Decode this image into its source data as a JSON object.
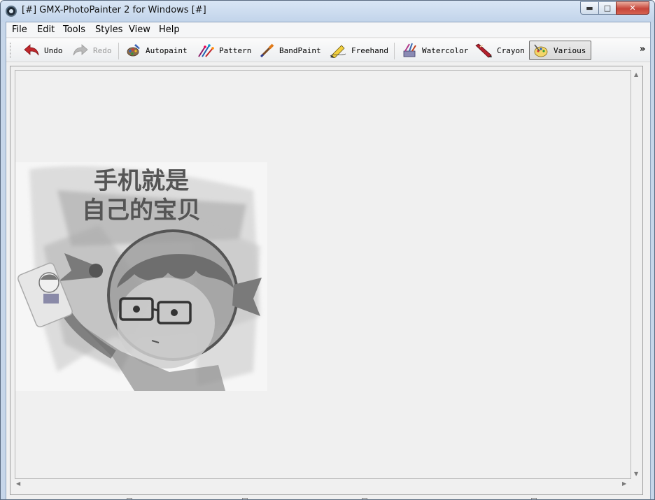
{
  "window": {
    "title": "[#] GMX-PhotoPainter 2 for Windows [#]",
    "caption_buttons": {
      "minimize": "▬",
      "maximize": "□",
      "close": "✕"
    }
  },
  "menu": {
    "items": [
      "File",
      "Edit",
      "Tools",
      "Styles",
      "View",
      "Help"
    ]
  },
  "toolbar": {
    "buttons": [
      {
        "label": "Undo",
        "icon": "undo-arrow-icon",
        "enabled": true,
        "active": false
      },
      {
        "label": "Redo",
        "icon": "redo-arrow-icon",
        "enabled": false,
        "active": false
      },
      {
        "label": "Autopaint",
        "icon": "palette-icon",
        "enabled": true,
        "active": false
      },
      {
        "label": "Pattern",
        "icon": "pattern-brushes-icon",
        "enabled": true,
        "active": false
      },
      {
        "label": "BandPaint",
        "icon": "band-brush-icon",
        "enabled": true,
        "active": false
      },
      {
        "label": "Freehand",
        "icon": "pencil-icon",
        "enabled": true,
        "active": false
      },
      {
        "label": "Watercolor",
        "icon": "watercolor-brushes-icon",
        "enabled": true,
        "active": false
      },
      {
        "label": "Crayon",
        "icon": "crayon-icon",
        "enabled": true,
        "active": false
      },
      {
        "label": "Various",
        "icon": "artist-palette-icon",
        "enabled": true,
        "active": true
      }
    ],
    "overflow": "»"
  },
  "canvas": {
    "image": {
      "caption_line1": "手机就是",
      "caption_line2": "自己的宝贝",
      "style": "grayscale watercolor sketch"
    }
  },
  "colors": {
    "titlebar": "#c6d6e9",
    "workspace": "#f0f0f0",
    "undo_red": "#c0262b"
  }
}
